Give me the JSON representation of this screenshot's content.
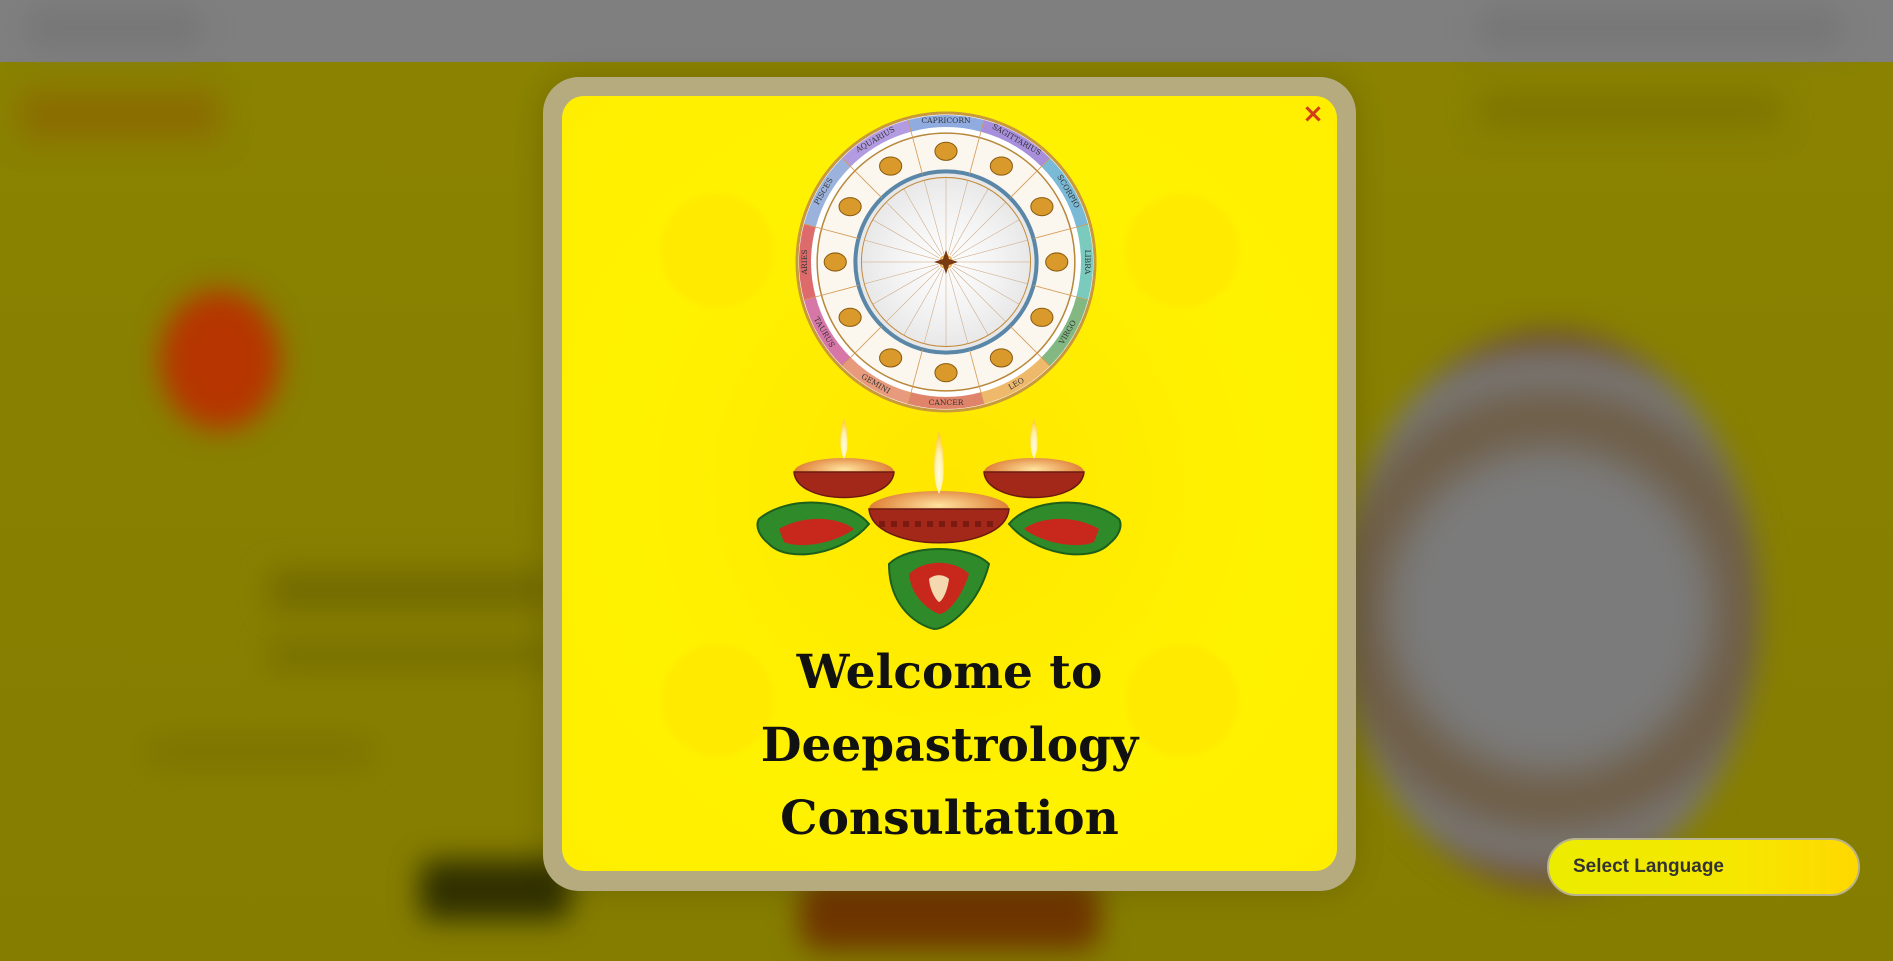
{
  "modal": {
    "close_label": "×",
    "title_lines": [
      "Welcome to",
      "Deepastrology",
      "Consultation"
    ]
  },
  "zodiac_labels": [
    "CAPRICORN",
    "SAGITTARIUS",
    "SCORPIO",
    "LIBRA",
    "VIRGO",
    "LEO",
    "CANCER",
    "GEMINI",
    "TAURUS",
    "ARIES",
    "PISCES",
    "AQUARIUS"
  ],
  "language_selector": {
    "label": "Select Language"
  },
  "colors": {
    "modal_background": "#fff200",
    "close_icon": "#d23a1a",
    "diya_body": "#a4281a",
    "leaf_green": "#2f8a2a"
  }
}
